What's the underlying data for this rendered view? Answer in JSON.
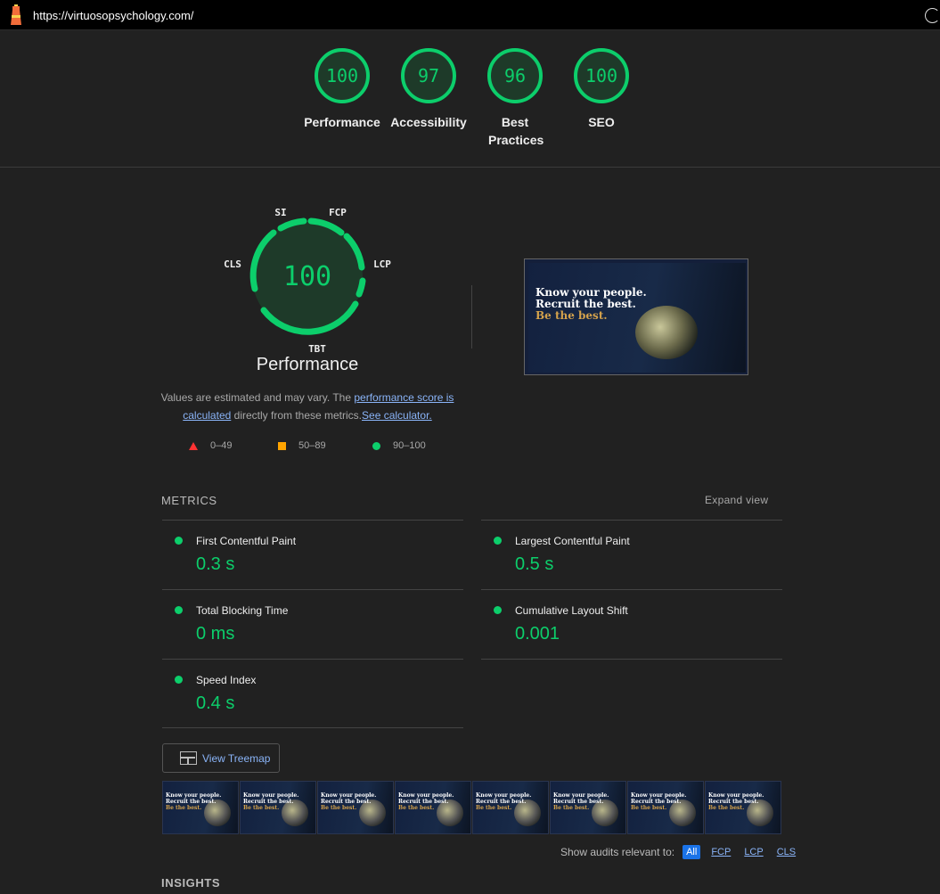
{
  "url": "https://virtuosopsychology.com/",
  "colors": {
    "pass": "#0cce6b",
    "average": "#ffa400",
    "fail": "#ff3333",
    "link": "#8ab4f8"
  },
  "categories": [
    {
      "score": "100",
      "label": "Performance"
    },
    {
      "score": "97",
      "label": "Accessibility"
    },
    {
      "score": "96",
      "label": "Best Practices"
    },
    {
      "score": "100",
      "label": "SEO"
    }
  ],
  "performance": {
    "score": "100",
    "title": "Performance",
    "gauge_labels": {
      "si": "SI",
      "fcp": "FCP",
      "lcp": "LCP",
      "tbt": "TBT",
      "cls": "CLS"
    },
    "disclaimer_pre": "Values are estimated and may vary. The",
    "disclaimer_link1": "performance score is calculated",
    "disclaimer_mid": "directly from these metrics.",
    "disclaimer_link2": "See calculator."
  },
  "legend": [
    {
      "range": "0–49",
      "icon": "fail-triangle"
    },
    {
      "range": "50–89",
      "icon": "average-square"
    },
    {
      "range": "90–100",
      "icon": "pass-circle"
    }
  ],
  "final_screenshot": {
    "line1": "Know your people.",
    "line2": "Recruit the best.",
    "line3": "Be the best."
  },
  "metrics": {
    "header": "METRICS",
    "expand_label": "Expand view",
    "items": [
      {
        "name": "First Contentful Paint",
        "value": "0.3 s"
      },
      {
        "name": "Largest Contentful Paint",
        "value": "0.5 s"
      },
      {
        "name": "Total Blocking Time",
        "value": "0 ms"
      },
      {
        "name": "Cumulative Layout Shift",
        "value": "0.001"
      },
      {
        "name": "Speed Index",
        "value": "0.4 s"
      }
    ]
  },
  "treemap_label": "View Treemap",
  "filmstrip_frames": 8,
  "audit_filter": {
    "label": "Show audits relevant to:",
    "options": [
      "All",
      "FCP",
      "LCP",
      "CLS"
    ],
    "active": "All"
  },
  "insights_header": "INSIGHTS"
}
